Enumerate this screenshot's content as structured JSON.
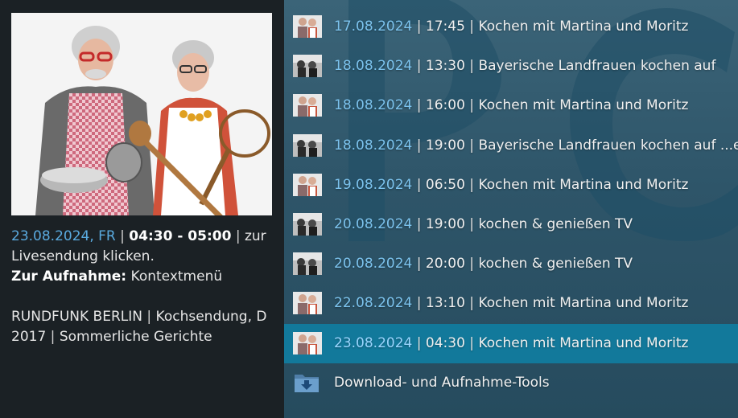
{
  "detail": {
    "date": "23.08.2024, FR",
    "time_range": "04:30 - 05:00",
    "hint_after": "zur Livesendung klicken.",
    "record_label": "Zur Aufnahme:",
    "record_value": "Kontextmenü",
    "channel": "RUNDFUNK BERLIN",
    "description_rest": "Kochsendung, D 2017",
    "subtitle": "Sommerliche Gerichte",
    "separator": "|"
  },
  "list": {
    "separator": "|",
    "items": [
      {
        "date": "17.08.2024",
        "time": "17:45",
        "title": "Kochen mit Martina und Moritz",
        "thumb": "chefs-thumbnail",
        "selected": false
      },
      {
        "date": "18.08.2024",
        "time": "13:30",
        "title": "Bayerische Landfrauen kochen auf",
        "thumb": "landfrauen-thumbnail",
        "selected": false
      },
      {
        "date": "18.08.2024",
        "time": "16:00",
        "title": "Kochen mit Martina und Moritz",
        "thumb": "chefs-thumbnail",
        "selected": false
      },
      {
        "date": "18.08.2024",
        "time": "19:00",
        "title": "Bayerische Landfrauen kochen auf ...ei",
        "thumb": "landfrauen-thumbnail",
        "selected": false
      },
      {
        "date": "19.08.2024",
        "time": "06:50",
        "title": "Kochen mit Martina und Moritz",
        "thumb": "chefs-thumbnail",
        "selected": false
      },
      {
        "date": "20.08.2024",
        "time": "19:00",
        "title": "kochen & genießen TV",
        "thumb": "landfrauen-thumbnail",
        "selected": false
      },
      {
        "date": "20.08.2024",
        "time": "20:00",
        "title": "kochen & genießen TV",
        "thumb": "landfrauen-thumbnail",
        "selected": false
      },
      {
        "date": "22.08.2024",
        "time": "13:10",
        "title": "Kochen mit Martina und Moritz",
        "thumb": "chefs-thumbnail",
        "selected": false
      },
      {
        "date": "23.08.2024",
        "time": "04:30",
        "title": "Kochen mit Martina und Moritz",
        "thumb": "chefs-thumbnail",
        "selected": true
      }
    ],
    "tools_label": "Download- und Aufnahme-Tools"
  },
  "colors": {
    "accent_date": "#7cc3ee",
    "selected_row": "#12799b",
    "left_background": "#1b2125"
  }
}
